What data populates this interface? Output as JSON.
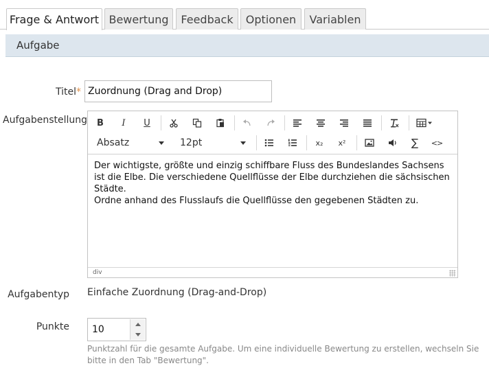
{
  "tabs": [
    {
      "label": "Frage & Antwort",
      "active": true
    },
    {
      "label": "Bewertung",
      "active": false
    },
    {
      "label": "Feedback",
      "active": false
    },
    {
      "label": "Optionen",
      "active": false
    },
    {
      "label": "Variablen",
      "active": false
    }
  ],
  "section": {
    "title": "Aufgabe"
  },
  "fields": {
    "title": {
      "label": "Titel",
      "required_mark": "*",
      "value": "Zuordnung (Drag and Drop)"
    },
    "task": {
      "label": "Aufgabenstellung"
    },
    "type": {
      "label": "Aufgabentyp",
      "value": "Einfache Zuordnung (Drag-and-Drop)"
    },
    "points": {
      "label": "Punkte",
      "value": "10",
      "hint": "Punktzahl für die gesamte Aufgabe. Um eine individuelle Bewertung zu erstellen, wechseln Sie bitte in den Tab \"Bewertung\"."
    }
  },
  "editor": {
    "toolbar": {
      "bold": "B",
      "italic": "I",
      "underline": "U",
      "format_select": "Absatz",
      "fontsize_select": "12pt",
      "subscript": "x₂",
      "superscript": "x²",
      "sum": "∑",
      "code": "<>"
    },
    "content_lines": [
      "Der wichtigste, größte und einzig schiffbare Fluss des Bundeslandes Sachsens ist die Elbe. Die verschiedene Quellflüsse der Elbe durchziehen die sächsischen Städte.",
      "Ordne anhand des Flusslaufs die Quellflüsse den gegebenen Städten zu."
    ],
    "status_path": "div"
  },
  "colors": {
    "section_bg": "#dde6ee",
    "required": "#e0914a",
    "hint_text": "#888888"
  }
}
